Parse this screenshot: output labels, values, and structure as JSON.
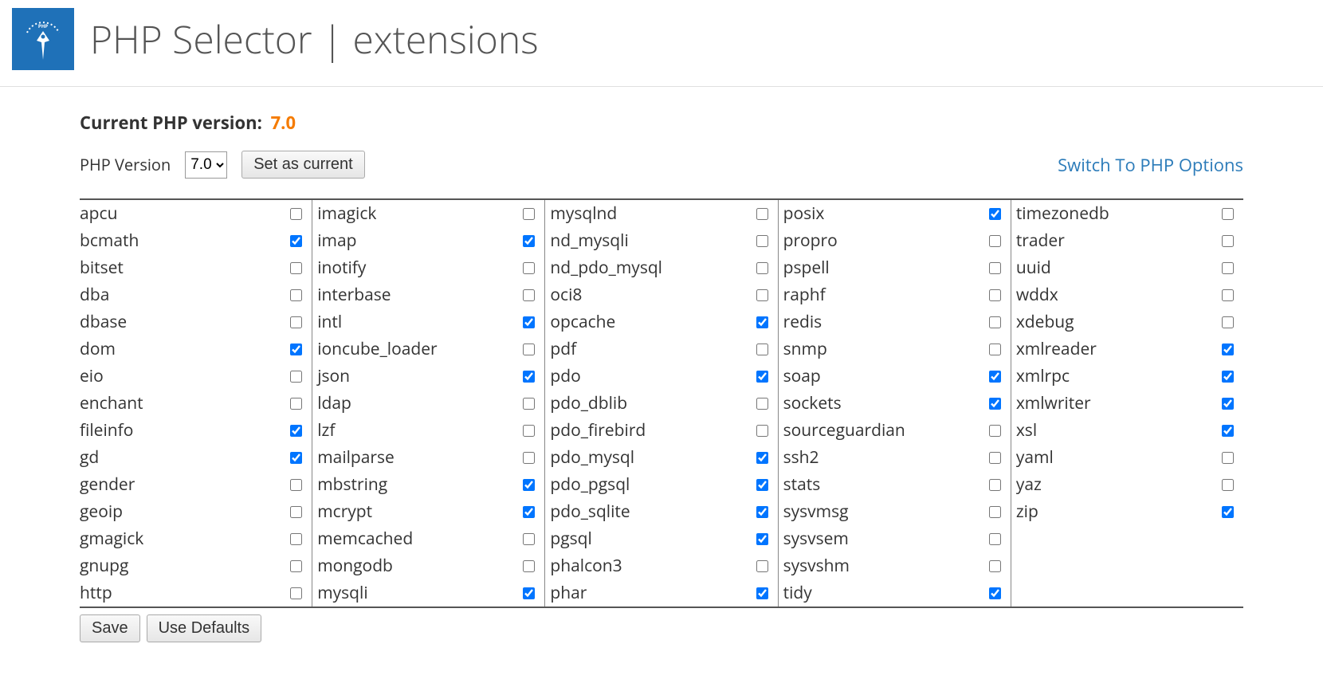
{
  "header": {
    "title": "PHP Selector | extensions"
  },
  "version": {
    "label": "Current PHP version:",
    "value": "7.0",
    "selector_label": "PHP Version",
    "selected": "7.0",
    "set_button": "Set as current",
    "switch_link": "Switch To PHP Options"
  },
  "footer": {
    "save": "Save",
    "defaults": "Use Defaults"
  },
  "columns": [
    [
      {
        "name": "apcu",
        "checked": false
      },
      {
        "name": "bcmath",
        "checked": true
      },
      {
        "name": "bitset",
        "checked": false
      },
      {
        "name": "dba",
        "checked": false
      },
      {
        "name": "dbase",
        "checked": false
      },
      {
        "name": "dom",
        "checked": true
      },
      {
        "name": "eio",
        "checked": false
      },
      {
        "name": "enchant",
        "checked": false
      },
      {
        "name": "fileinfo",
        "checked": true
      },
      {
        "name": "gd",
        "checked": true
      },
      {
        "name": "gender",
        "checked": false
      },
      {
        "name": "geoip",
        "checked": false
      },
      {
        "name": "gmagick",
        "checked": false
      },
      {
        "name": "gnupg",
        "checked": false
      },
      {
        "name": "http",
        "checked": false
      }
    ],
    [
      {
        "name": "imagick",
        "checked": false
      },
      {
        "name": "imap",
        "checked": true
      },
      {
        "name": "inotify",
        "checked": false
      },
      {
        "name": "interbase",
        "checked": false
      },
      {
        "name": "intl",
        "checked": true
      },
      {
        "name": "ioncube_loader",
        "checked": false
      },
      {
        "name": "json",
        "checked": true
      },
      {
        "name": "ldap",
        "checked": false
      },
      {
        "name": "lzf",
        "checked": false
      },
      {
        "name": "mailparse",
        "checked": false
      },
      {
        "name": "mbstring",
        "checked": true
      },
      {
        "name": "mcrypt",
        "checked": true
      },
      {
        "name": "memcached",
        "checked": false
      },
      {
        "name": "mongodb",
        "checked": false
      },
      {
        "name": "mysqli",
        "checked": true
      }
    ],
    [
      {
        "name": "mysqlnd",
        "checked": false
      },
      {
        "name": "nd_mysqli",
        "checked": false
      },
      {
        "name": "nd_pdo_mysql",
        "checked": false
      },
      {
        "name": "oci8",
        "checked": false
      },
      {
        "name": "opcache",
        "checked": true
      },
      {
        "name": "pdf",
        "checked": false
      },
      {
        "name": "pdo",
        "checked": true
      },
      {
        "name": "pdo_dblib",
        "checked": false
      },
      {
        "name": "pdo_firebird",
        "checked": false
      },
      {
        "name": "pdo_mysql",
        "checked": true
      },
      {
        "name": "pdo_pgsql",
        "checked": true
      },
      {
        "name": "pdo_sqlite",
        "checked": true
      },
      {
        "name": "pgsql",
        "checked": true
      },
      {
        "name": "phalcon3",
        "checked": false
      },
      {
        "name": "phar",
        "checked": true
      }
    ],
    [
      {
        "name": "posix",
        "checked": true
      },
      {
        "name": "propro",
        "checked": false
      },
      {
        "name": "pspell",
        "checked": false
      },
      {
        "name": "raphf",
        "checked": false
      },
      {
        "name": "redis",
        "checked": false
      },
      {
        "name": "snmp",
        "checked": false
      },
      {
        "name": "soap",
        "checked": true
      },
      {
        "name": "sockets",
        "checked": true
      },
      {
        "name": "sourceguardian",
        "checked": false
      },
      {
        "name": "ssh2",
        "checked": false
      },
      {
        "name": "stats",
        "checked": false
      },
      {
        "name": "sysvmsg",
        "checked": false
      },
      {
        "name": "sysvsem",
        "checked": false
      },
      {
        "name": "sysvshm",
        "checked": false
      },
      {
        "name": "tidy",
        "checked": true
      }
    ],
    [
      {
        "name": "timezonedb",
        "checked": false
      },
      {
        "name": "trader",
        "checked": false
      },
      {
        "name": "uuid",
        "checked": false
      },
      {
        "name": "wddx",
        "checked": false
      },
      {
        "name": "xdebug",
        "checked": false
      },
      {
        "name": "xmlreader",
        "checked": true
      },
      {
        "name": "xmlrpc",
        "checked": true
      },
      {
        "name": "xmlwriter",
        "checked": true
      },
      {
        "name": "xsl",
        "checked": true
      },
      {
        "name": "yaml",
        "checked": false
      },
      {
        "name": "yaz",
        "checked": false
      },
      {
        "name": "zip",
        "checked": true
      }
    ]
  ]
}
